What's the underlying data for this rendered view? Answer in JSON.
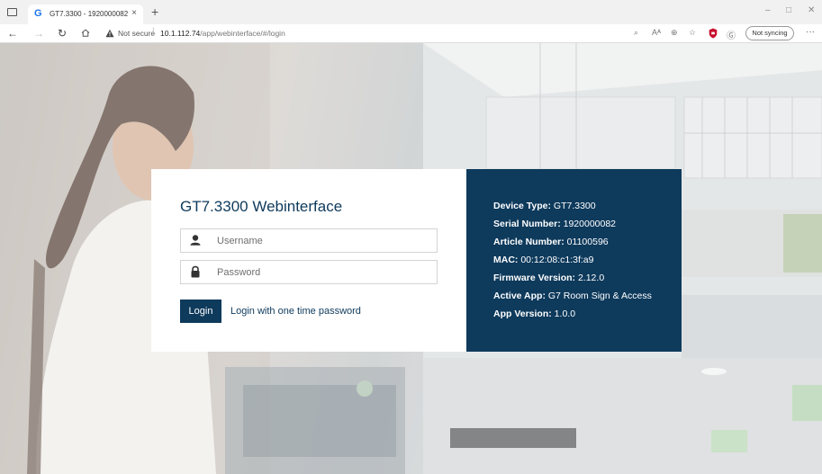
{
  "browser": {
    "tab_title": "GT7.3300 - 1920000082",
    "tab_close": "×",
    "new_tab": "+",
    "win_minimize": "–",
    "win_maximize": "□",
    "win_close": "✕",
    "security_label": "Not secure",
    "url_host": "10.1.112.74",
    "url_path": "/app/webinterface/#/login",
    "sync_label": "Not syncing",
    "more_label": "···",
    "toolbar_icons": [
      "read-aloud-icon",
      "text-size-icon",
      "zoom-icon",
      "favorites-icon",
      "shield-icon",
      "refresh-circle-icon"
    ]
  },
  "login": {
    "title": "GT7.3300 Webinterface",
    "username_placeholder": "Username",
    "password_placeholder": "Password",
    "login_button": "Login",
    "otp_link": "Login with one time password"
  },
  "device_info": [
    {
      "label": "Device Type:",
      "value": " GT7.3300"
    },
    {
      "label": "Serial Number:",
      "value": " 1920000082"
    },
    {
      "label": "Article Number:",
      "value": " 01100596"
    },
    {
      "label": "MAC:",
      "value": " 00:12:08:c1:3f:a9"
    },
    {
      "label": "Firmware Version:",
      "value": " 2.12.0"
    },
    {
      "label": "Active App:",
      "value": " G7 Room Sign & Access"
    },
    {
      "label": "App Version:",
      "value": " 1.0.0"
    }
  ],
  "colors": {
    "brand": "#0e3a5c",
    "card_background": "#ffffff"
  }
}
